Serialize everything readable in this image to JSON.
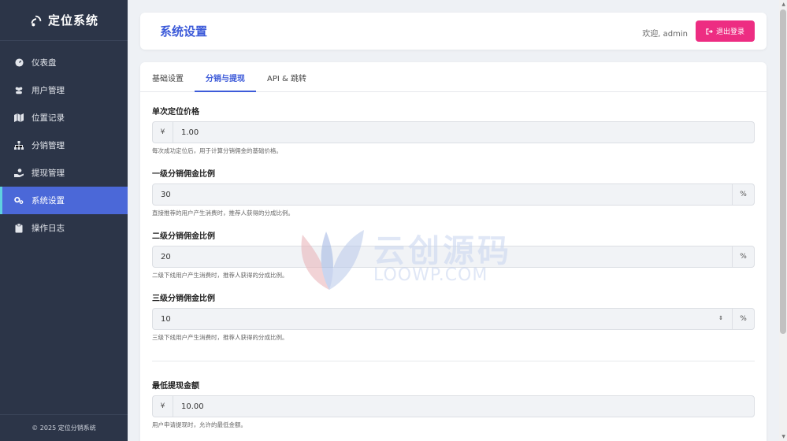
{
  "brand": {
    "title": "定位系统"
  },
  "sidebar": {
    "items": [
      {
        "label": "仪表盘",
        "icon": "dashboard-icon",
        "active": false
      },
      {
        "label": "用户管理",
        "icon": "users-icon",
        "active": false
      },
      {
        "label": "位置记录",
        "icon": "map-icon",
        "active": false
      },
      {
        "label": "分销管理",
        "icon": "sitemap-icon",
        "active": false
      },
      {
        "label": "提现管理",
        "icon": "withdraw-icon",
        "active": false
      },
      {
        "label": "系统设置",
        "icon": "cogs-icon",
        "active": true
      },
      {
        "label": "操作日志",
        "icon": "clipboard-icon",
        "active": false
      }
    ],
    "footer": "© 2025 定位分销系统"
  },
  "header": {
    "title": "系统设置",
    "welcome": "欢迎, admin",
    "logout_label": "退出登录"
  },
  "tabs": [
    {
      "label": "基础设置",
      "active": false
    },
    {
      "label": "分销与提现",
      "active": true
    },
    {
      "label": "API & 跳转",
      "active": false
    }
  ],
  "form": {
    "price": {
      "label": "单次定位价格",
      "prefix": "¥",
      "value": "1.00",
      "help": "每次成功定位后，用于计算分销佣金的基础价格。"
    },
    "level1": {
      "label": "一级分销佣金比例",
      "value": "30",
      "suffix": "%",
      "help": "直接推荐的用户产生消费时，推荐人获得的分成比例。"
    },
    "level2": {
      "label": "二级分销佣金比例",
      "value": "20",
      "suffix": "%",
      "help": "二级下线用户产生消费时，推荐人获得的分成比例。"
    },
    "level3": {
      "label": "三级分销佣金比例",
      "value": "10",
      "suffix": "%",
      "help": "三级下线用户产生消费时，推荐人获得的分成比例。"
    },
    "min_withdraw": {
      "label": "最低提现金额",
      "prefix": "¥",
      "value": "10.00",
      "help": "用户申请提现时，允许的最低金额。"
    }
  },
  "watermark": {
    "cn": "云创源码",
    "en": "LOOWP.COM"
  },
  "colors": {
    "sidebar_bg": "#2c3548",
    "accent": "#3d5bd9",
    "active_nav": "#4b68d8",
    "logout": "#ed2d82"
  }
}
